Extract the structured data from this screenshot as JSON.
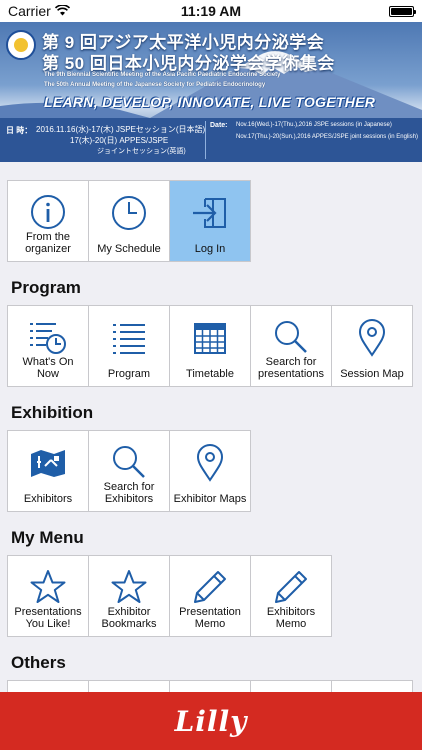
{
  "status_bar": {
    "carrier": "Carrier",
    "time": "11:19 AM",
    "battery_level": 1.0
  },
  "banner": {
    "title_line1": "第 9 回アジア太平洋小児内分泌学会",
    "title_line2": "第 50 回日本小児内分泌学会学術集会",
    "sub_line1": "The 9th Biennial Scientific Meeting of the Asia Pacific Paediatric Endocrine Society",
    "sub_line2": "The 50th Annual Meeting of the Japanese Society for Pediatric Endocrinology",
    "slogan": "LEARN, DEVELOP, INNOVATE, LIVE TOGETHER",
    "date_label": "日 時：",
    "date_line1": "2016.11.16(水)-17(木)  JSPEセッション(日本語)",
    "date_line2": "17(木)-20(日)  APPES/JSPE",
    "date_line3": "ジョイントセッション(英語)",
    "date_en_label": "Date:",
    "date_en_line1": "Nov.16(Wed.)-17(Thu.),2016 JSPE sessions (in Japanese)",
    "date_en_line2": "Nov.17(Thu.)-20(Sun.),2016 APPES/JSPE joint sessions (in English)"
  },
  "top_tiles": [
    {
      "label": "From the organizer",
      "icon": "info-icon"
    },
    {
      "label": "My Schedule",
      "icon": "clock-icon"
    },
    {
      "label": "Log In",
      "icon": "login-icon",
      "active": true
    }
  ],
  "sections": {
    "program": {
      "title": "Program",
      "tiles": [
        {
          "label": "What's On Now",
          "icon": "list-clock-icon"
        },
        {
          "label": "Program",
          "icon": "list-icon"
        },
        {
          "label": "Timetable",
          "icon": "calendar-grid-icon"
        },
        {
          "label": "Search for presentations",
          "icon": "search-icon"
        },
        {
          "label": "Session Map",
          "icon": "map-pin-icon"
        }
      ]
    },
    "exhibition": {
      "title": "Exhibition",
      "tiles": [
        {
          "label": "Exhibitors",
          "icon": "exhibitor-map-icon"
        },
        {
          "label": "Search for Exhibitors",
          "icon": "search-icon"
        },
        {
          "label": "Exhibitor Maps",
          "icon": "map-pin-icon"
        }
      ]
    },
    "my_menu": {
      "title": "My Menu",
      "tiles": [
        {
          "label": "Presentations You Like!",
          "icon": "star-icon"
        },
        {
          "label": "Exhibitor Bookmarks",
          "icon": "star-icon"
        },
        {
          "label": "Presentation Memo",
          "icon": "pencil-icon"
        },
        {
          "label": "Exhibitors Memo",
          "icon": "pencil-icon"
        }
      ]
    },
    "others": {
      "title": "Others"
    }
  },
  "footer": {
    "brand": "Lilly"
  },
  "colors": {
    "accent": "#1f5ea8",
    "footer": "#d42a21",
    "login_tile": "#8fc4f0"
  }
}
